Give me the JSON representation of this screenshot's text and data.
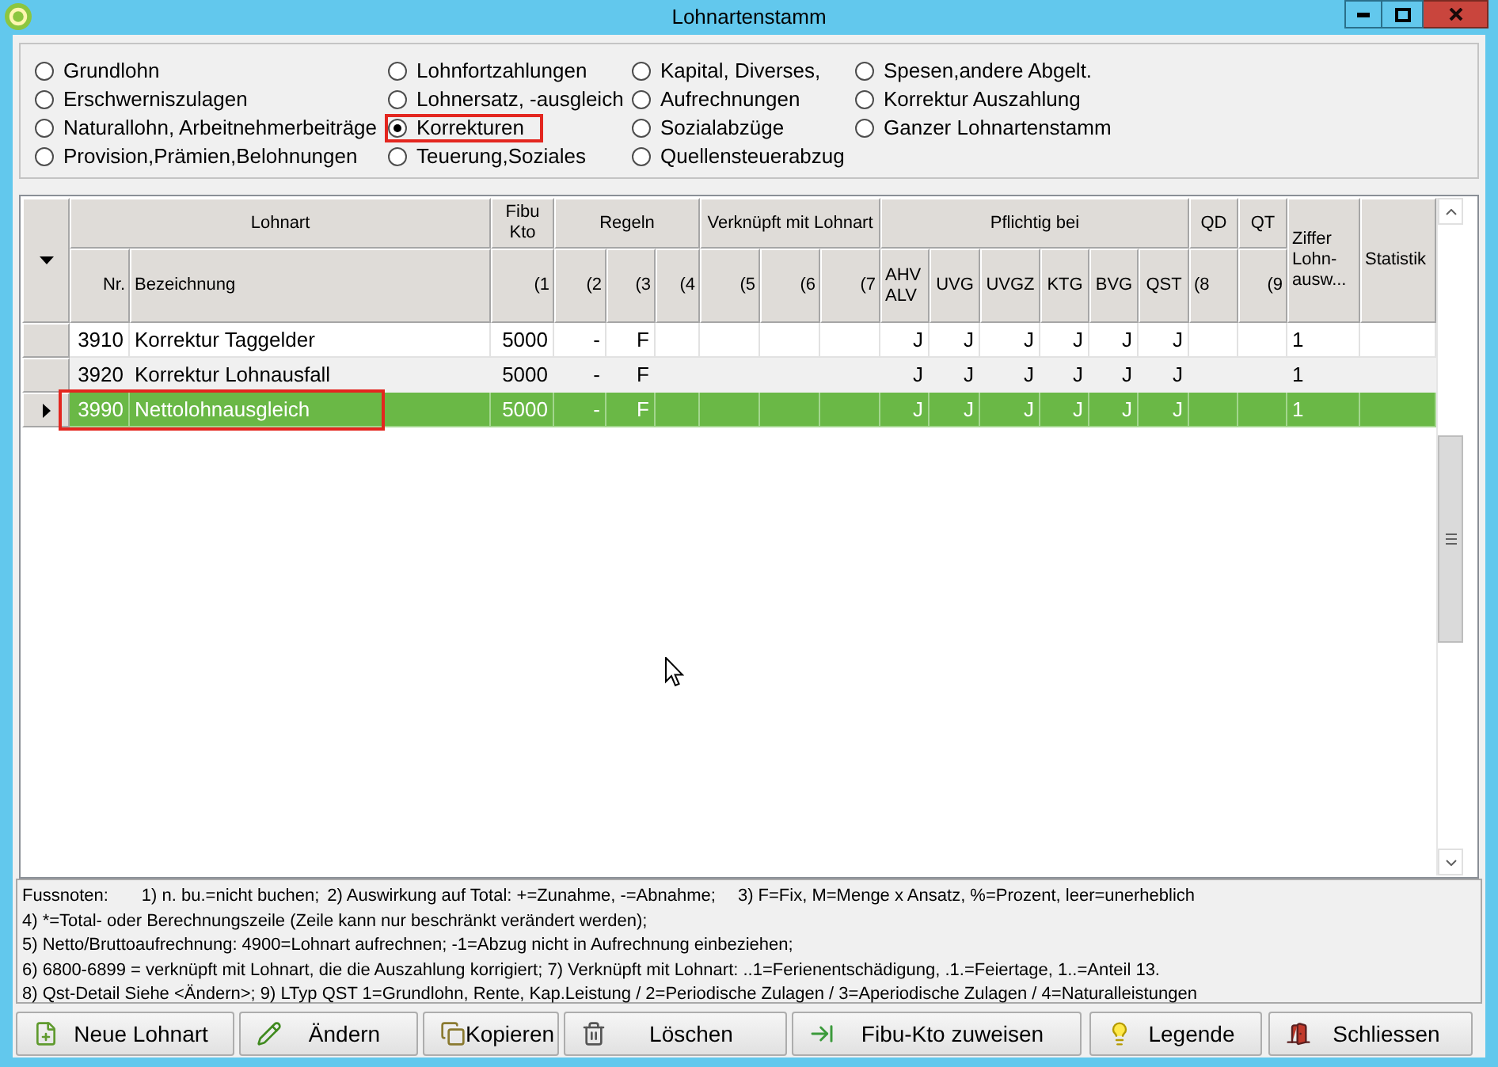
{
  "window": {
    "title": "Lohnartenstamm"
  },
  "radio_columns": [
    {
      "options": [
        {
          "label": "Grundlohn",
          "selected": false,
          "highlighted": false
        },
        {
          "label": "Erschwerniszulagen",
          "selected": false,
          "highlighted": false
        },
        {
          "label": "Naturallohn, Arbeitnehmerbeiträge",
          "selected": false,
          "highlighted": false
        },
        {
          "label": "Provision,Prämien,Belohnungen",
          "selected": false,
          "highlighted": false
        }
      ]
    },
    {
      "options": [
        {
          "label": "Lohnfortzahlungen",
          "selected": false,
          "highlighted": false
        },
        {
          "label": "Lohnersatz, -ausgleich",
          "selected": false,
          "highlighted": false
        },
        {
          "label": "Korrekturen",
          "selected": true,
          "highlighted": true
        },
        {
          "label": "Teuerung,Soziales",
          "selected": false,
          "highlighted": false
        }
      ]
    },
    {
      "options": [
        {
          "label": "Kapital, Diverses,",
          "selected": false,
          "highlighted": false
        },
        {
          "label": "Aufrechnungen",
          "selected": false,
          "highlighted": false
        },
        {
          "label": "Sozialabzüge",
          "selected": false,
          "highlighted": false
        },
        {
          "label": "Quellensteuerabzug",
          "selected": false,
          "highlighted": false
        }
      ]
    },
    {
      "options": [
        {
          "label": "Spesen,andere Abgelt.",
          "selected": false,
          "highlighted": false
        },
        {
          "label": "Korrektur Auszahlung",
          "selected": false,
          "highlighted": false
        },
        {
          "label": "Ganzer Lohnartenstamm",
          "selected": false,
          "highlighted": false
        }
      ]
    }
  ],
  "table": {
    "header_groups": [
      {
        "label": "Lohnart",
        "columns": [
          "Nr.",
          "Bezeichnung"
        ]
      },
      {
        "label": "Fibu\nKto",
        "columns": [
          "(1"
        ]
      },
      {
        "label": "Regeln",
        "columns": [
          "(2",
          "(3",
          "(4"
        ]
      },
      {
        "label": "Verknüpft mit Lohnart",
        "columns": [
          "(5",
          "(6",
          "(7"
        ]
      },
      {
        "label": "Pflichtig bei",
        "columns": [
          "AHV\nALV",
          "UVG",
          "UVGZ",
          "KTG",
          "BVG",
          "QST"
        ]
      },
      {
        "label": "QD",
        "columns": [
          "(8"
        ]
      },
      {
        "label": "QT",
        "columns": [
          "(9"
        ]
      },
      {
        "label": "Ziffer\nLohn-\nausw..."
      },
      {
        "label": "Statistik"
      }
    ],
    "rows": [
      {
        "selected": false,
        "highlighted": false,
        "cells": [
          "3910",
          "Korrektur Taggelder",
          "5000",
          "-",
          "F",
          null,
          null,
          null,
          null,
          "J",
          "J",
          "J",
          "J",
          "J",
          "J",
          null,
          null,
          "1",
          null
        ]
      },
      {
        "selected": false,
        "highlighted": false,
        "cells": [
          "3920",
          "Korrektur Lohnausfall",
          "5000",
          "-",
          "F",
          null,
          null,
          null,
          null,
          "J",
          "J",
          "J",
          "J",
          "J",
          "J",
          null,
          null,
          "1",
          null
        ]
      },
      {
        "selected": true,
        "highlighted": true,
        "cells": [
          "3990",
          "Nettolohnausgleich",
          "5000",
          "-",
          "F",
          null,
          null,
          null,
          null,
          "J",
          "J",
          "J",
          "J",
          "J",
          "J",
          null,
          null,
          "1",
          null
        ]
      }
    ]
  },
  "footnotes": {
    "title": "Fussnoten:",
    "first_line": [
      "1) n. bu.=nicht buchen;",
      "2) Auswirkung auf Total: +=Zunahme, -=Abnahme;",
      "3) F=Fix, M=Menge x Ansatz, %=Prozent, leer=unerheblich"
    ],
    "lines": [
      "4) *=Total- oder Berechnungszeile (Zeile kann nur beschränkt verändert werden);",
      "5) Netto/Bruttoaufrechnung: 4900=Lohnart aufrechnen; -1=Abzug nicht in Aufrechnung einbeziehen;",
      "6) 6800-6899 = verknüpft mit Lohnart, die die Auszahlung korrigiert; 7) Verknüpft mit Lohnart: ..1=Ferienentschädigung, .1.=Feiertage, 1..=Anteil 13.",
      "8) Qst-Detail Siehe <Ändern>; 9) LTyp QST 1=Grundlohn, Rente, Kap.Leistung / 2=Periodische Zulagen / 3=Aperiodische Zulagen / 4=Naturalleistungen"
    ]
  },
  "buttons": [
    "Neue Lohnart",
    "Ändern",
    "Kopieren",
    "Löschen",
    "Fibu-Kto zuweisen",
    "Legende",
    "Schliessen"
  ]
}
